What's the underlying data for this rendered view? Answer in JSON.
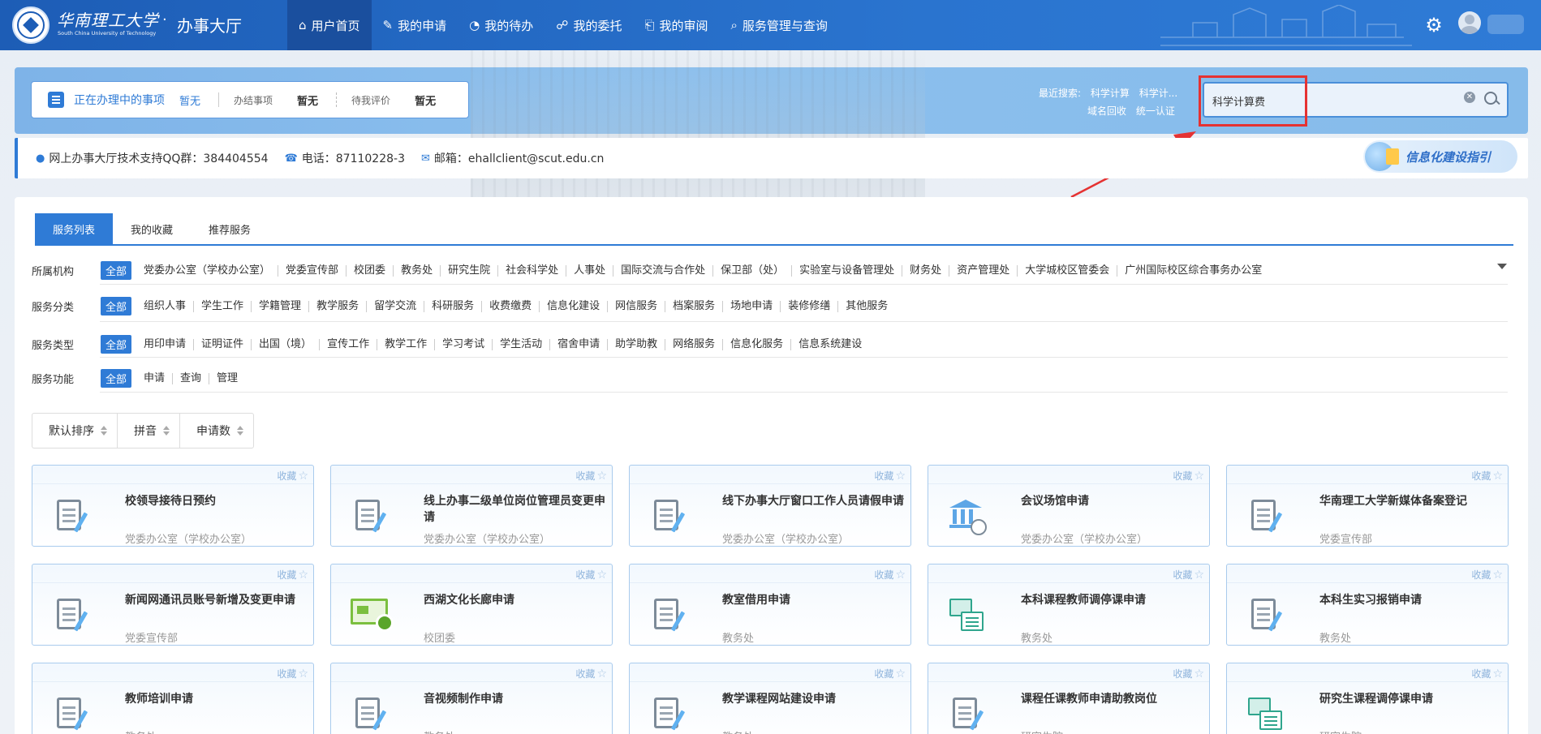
{
  "brand": {
    "name_cn": "华南理工大学",
    "name_en": "South China University of Technology",
    "dot": "·",
    "hall": "办事大厅"
  },
  "nav": [
    {
      "label": "用户首页",
      "icon": "home-icon",
      "glyph": "⌂",
      "active": true
    },
    {
      "label": "我的申请",
      "icon": "apply-icon",
      "glyph": "✎",
      "active": false
    },
    {
      "label": "我的待办",
      "icon": "todo-icon",
      "glyph": "◔",
      "active": false
    },
    {
      "label": "我的委托",
      "icon": "delegate-icon",
      "glyph": "☍",
      "active": false
    },
    {
      "label": "我的审阅",
      "icon": "review-icon",
      "glyph": "⎗",
      "active": false
    },
    {
      "label": "服务管理与查询",
      "icon": "service-query-icon",
      "glyph": "⌕",
      "active": false
    }
  ],
  "status": {
    "in_progress_label": "正在办理中的事项",
    "in_progress_value": "暂无",
    "done_label": "办结事项",
    "done_value": "暂无",
    "pending_rate_label": "待我评价",
    "pending_rate_value": "暂无"
  },
  "recent": {
    "label": "最近搜索:",
    "items": [
      "科学计算",
      "科学计...",
      "域名回收",
      "统一认证"
    ]
  },
  "search": {
    "value": "科学计算费",
    "placeholder": ""
  },
  "info": {
    "qq": "网上办事大厅技术支持QQ群：384404554",
    "phone": "电话：87110228-3",
    "email": "邮箱：ehallclient@scut.edu.cn",
    "guide": "信息化建设指引"
  },
  "tabs": [
    {
      "label": "服务列表",
      "active": true
    },
    {
      "label": "我的收藏",
      "active": false
    },
    {
      "label": "推荐服务",
      "active": false
    }
  ],
  "filters": [
    {
      "label": "所属机构",
      "all": "全部",
      "options": [
        "党委办公室（学校办公室）",
        "党委宣传部",
        "校团委",
        "教务处",
        "研究生院",
        "社会科学处",
        "人事处",
        "国际交流与合作处",
        "保卫部（处）",
        "实验室与设备管理处",
        "财务处",
        "资产管理处",
        "大学城校区管委会",
        "广州国际校区综合事务办公室"
      ]
    },
    {
      "label": "服务分类",
      "all": "全部",
      "options": [
        "组织人事",
        "学生工作",
        "学籍管理",
        "教学服务",
        "留学交流",
        "科研服务",
        "收费缴费",
        "信息化建设",
        "网信服务",
        "档案服务",
        "场地申请",
        "装修修缮",
        "其他服务"
      ]
    },
    {
      "label": "服务类型",
      "all": "全部",
      "options": [
        "用印申请",
        "证明证件",
        "出国（境）",
        "宣传工作",
        "教学工作",
        "学习考试",
        "学生活动",
        "宿舍申请",
        "助学助教",
        "网络服务",
        "信息化服务",
        "信息系统建设"
      ]
    },
    {
      "label": "服务功能",
      "all": "全部",
      "options": [
        "申请",
        "查询",
        "管理"
      ]
    }
  ],
  "sort": [
    "默认排序",
    "拼音",
    "申请数"
  ],
  "card_fav_label": "收藏",
  "cards": [
    {
      "title": "校领导接待日预约",
      "dept": "党委办公室（学校办公室）",
      "icon": "doc-edit-icon"
    },
    {
      "title": "线上办事二级单位岗位管理员变更申请",
      "dept": "党委办公室（学校办公室）",
      "icon": "doc-edit-icon"
    },
    {
      "title": "线下办事大厅窗口工作人员请假申请",
      "dept": "党委办公室（学校办公室）",
      "icon": "doc-edit-icon"
    },
    {
      "title": "会议场馆申请",
      "dept": "党委办公室（学校办公室）",
      "icon": "building-clock-icon"
    },
    {
      "title": "华南理工大学新媒体备案登记",
      "dept": "党委宣传部",
      "icon": "doc-edit-icon"
    },
    {
      "title": "新闻网通讯员账号新增及变更申请",
      "dept": "党委宣传部",
      "icon": "doc-edit-icon"
    },
    {
      "title": "西湖文化长廊申请",
      "dept": "校团委",
      "icon": "certificate-icon"
    },
    {
      "title": "教室借用申请",
      "dept": "教务处",
      "icon": "doc-edit-icon"
    },
    {
      "title": "本科课程教师调停课申请",
      "dept": "教务处",
      "icon": "swap-doc-icon"
    },
    {
      "title": "本科生实习报销申请",
      "dept": "教务处",
      "icon": "doc-edit-icon"
    },
    {
      "title": "教师培训申请",
      "dept": "教务处",
      "icon": "doc-edit-icon"
    },
    {
      "title": "音视频制作申请",
      "dept": "教务处",
      "icon": "doc-edit-icon"
    },
    {
      "title": "教学课程网站建设申请",
      "dept": "教务处",
      "icon": "doc-edit-icon"
    },
    {
      "title": "课程任课教师申请助教岗位",
      "dept": "研究生院",
      "icon": "doc-edit-icon"
    },
    {
      "title": "研究生课程调停课申请",
      "dept": "研究生院",
      "icon": "swap-doc-icon"
    }
  ]
}
